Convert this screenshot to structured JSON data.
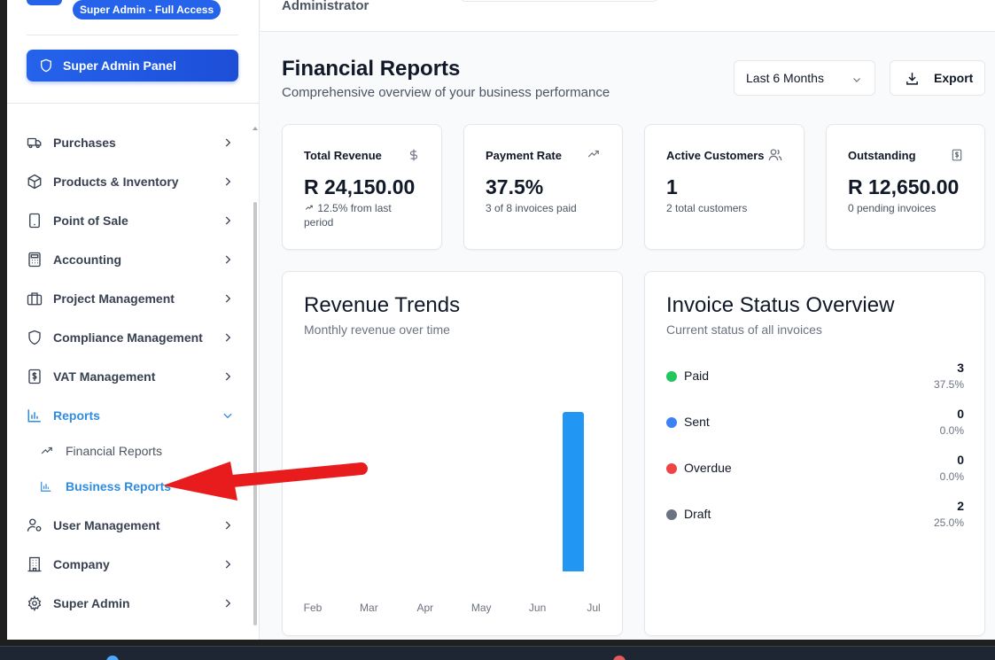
{
  "sidebar": {
    "role_badge": "Super Admin - Full Access",
    "admin_panel_label": "Super Admin Panel",
    "items": [
      {
        "label": "Purchases",
        "icon": "truck-icon"
      },
      {
        "label": "Products & Inventory",
        "icon": "box-icon"
      },
      {
        "label": "Point of Sale",
        "icon": "tablet-icon"
      },
      {
        "label": "Accounting",
        "icon": "calculator-icon"
      },
      {
        "label": "Project Management",
        "icon": "briefcase-icon"
      },
      {
        "label": "Compliance Management",
        "icon": "shield-icon"
      },
      {
        "label": "VAT Management",
        "icon": "receipt-dollar-icon"
      },
      {
        "label": "Reports",
        "icon": "bar-chart-icon"
      },
      {
        "label": "User Management",
        "icon": "user-cog-icon"
      },
      {
        "label": "Company",
        "icon": "building-icon"
      },
      {
        "label": "Super Admin",
        "icon": "gear-icon"
      }
    ],
    "reports_sub": [
      {
        "label": "Financial Reports",
        "icon": "trending-up-icon"
      },
      {
        "label": "Business Reports",
        "icon": "bar-chart-icon"
      }
    ]
  },
  "header": {
    "role": "Administrator"
  },
  "main": {
    "title": "Financial Reports",
    "subtitle": "Comprehensive overview of your business performance",
    "period": "Last 6 Months",
    "export_label": "Export",
    "stats": [
      {
        "label": "Total Revenue",
        "value": "R 24,150.00",
        "note": "12.5% from last period",
        "icon": "dollar-icon"
      },
      {
        "label": "Payment Rate",
        "value": "37.5%",
        "note": "3 of 8 invoices paid",
        "icon": "trending-up-icon"
      },
      {
        "label": "Active Customers",
        "value": "1",
        "note": "2 total customers",
        "icon": "users-icon"
      },
      {
        "label": "Outstanding",
        "value": "R 12,650.00",
        "note": "0 pending invoices",
        "icon": "receipt-dollar-icon"
      }
    ],
    "revenue_panel": {
      "title": "Revenue Trends",
      "subtitle": "Monthly revenue over time"
    },
    "status_panel": {
      "title": "Invoice Status Overview",
      "subtitle": "Current status of all invoices",
      "rows": [
        {
          "name": "Paid",
          "count": "3",
          "pct": "37.5%",
          "color": "#22c55e"
        },
        {
          "name": "Sent",
          "count": "0",
          "pct": "0.0%",
          "color": "#3b82f6"
        },
        {
          "name": "Overdue",
          "count": "0",
          "pct": "0.0%",
          "color": "#ef4444"
        },
        {
          "name": "Draft",
          "count": "2",
          "pct": "25.0%",
          "color": "#6b7280"
        }
      ]
    }
  },
  "chart_data": {
    "type": "bar",
    "categories": [
      "Feb",
      "Mar",
      "Apr",
      "May",
      "Jun",
      "Jul"
    ],
    "values": [
      0,
      0,
      0,
      0,
      0,
      24150
    ],
    "color": "#2196f3"
  },
  "colors": {
    "accent": "#2563eb",
    "active_nav": "#2f8ce0",
    "annotation_arrow": "#e81c1c"
  }
}
